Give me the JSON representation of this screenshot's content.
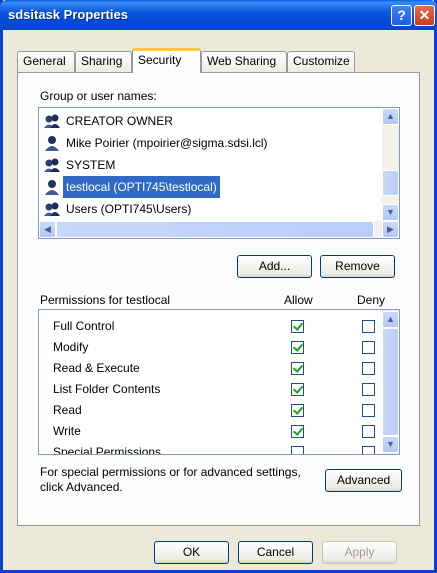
{
  "window": {
    "title": "sdsitask Properties",
    "help_glyph": "?",
    "close_glyph": "✕"
  },
  "tabs": [
    {
      "label": "General"
    },
    {
      "label": "Sharing"
    },
    {
      "label": "Security"
    },
    {
      "label": "Web Sharing"
    },
    {
      "label": "Customize"
    }
  ],
  "active_tab": "Security",
  "group_label": "Group or user names:",
  "users": [
    {
      "name": "CREATOR OWNER",
      "icon": "group-icon"
    },
    {
      "name": "Mike Poirier (mpoirier@sigma.sdsi.lcl)",
      "icon": "user-icon"
    },
    {
      "name": "SYSTEM",
      "icon": "group-icon"
    },
    {
      "name": "testlocal (OPTI745\\testlocal)",
      "icon": "user-icon",
      "selected": true
    },
    {
      "name": "Users (OPTI745\\Users)",
      "icon": "group-icon"
    }
  ],
  "buttons": {
    "add": "Add...",
    "remove": "Remove",
    "advanced": "Advanced",
    "ok": "OK",
    "cancel": "Cancel",
    "apply": "Apply"
  },
  "permissions": {
    "header": "Permissions for testlocal",
    "allow_label": "Allow",
    "deny_label": "Deny",
    "items": [
      {
        "name": "Full Control",
        "allow": true,
        "deny": false
      },
      {
        "name": "Modify",
        "allow": true,
        "deny": false
      },
      {
        "name": "Read & Execute",
        "allow": true,
        "deny": false
      },
      {
        "name": "List Folder Contents",
        "allow": true,
        "deny": false
      },
      {
        "name": "Read",
        "allow": true,
        "deny": false
      },
      {
        "name": "Write",
        "allow": true,
        "deny": false
      },
      {
        "name": "Special Permissions",
        "allow": false,
        "deny": false
      }
    ]
  },
  "advanced_note": "For special permissions or for advanced settings, click Advanced.",
  "colors": {
    "titlebar": "#0842d1",
    "selection": "#316ac5",
    "check": "#21a121",
    "tab_highlight": "#ffc83c"
  }
}
